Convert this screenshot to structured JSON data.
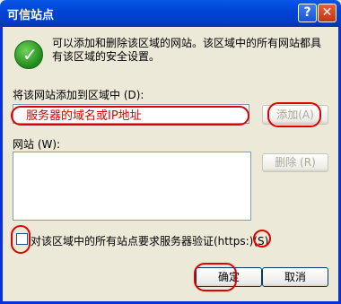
{
  "window": {
    "title": "可信站点",
    "help_label": "?",
    "close_label": "✕"
  },
  "info_text": "可以添加和删除该区域的网站。该区域中的所有网站都具有该区域的安全设置。",
  "add_section": {
    "label": "将该网站添加到区域中 (D):",
    "input_value": "服务器的域名或IP地址",
    "add_button": "添加(A)"
  },
  "sites_section": {
    "label": "网站 (W):",
    "remove_button": "删除 (R)"
  },
  "https_checkbox": {
    "label": "对该区域中的所有站点要求服务器验证(https:)(S)",
    "checked": false
  },
  "buttons": {
    "ok": "确定",
    "cancel": "取消"
  },
  "icons": {
    "info": "green-check-icon"
  },
  "colors": {
    "annotation": "#e00000",
    "title_bar": "#0045d8"
  }
}
